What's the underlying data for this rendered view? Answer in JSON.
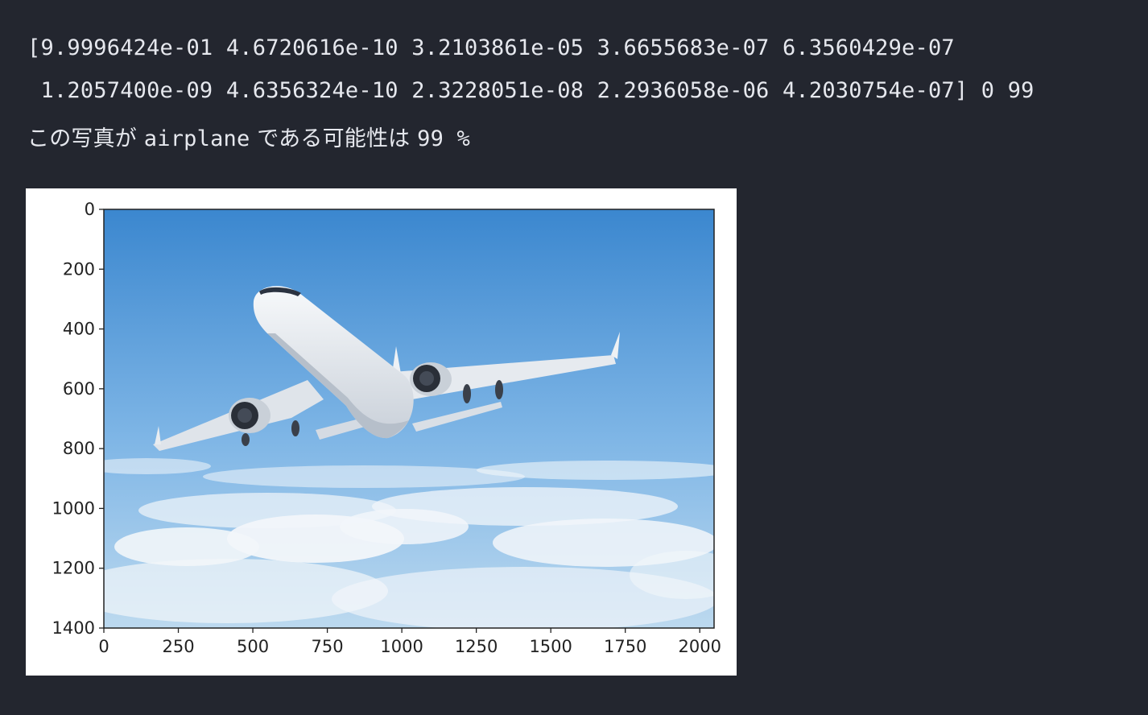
{
  "output": {
    "line1": "[9.9996424e-01 4.6720616e-10 3.2103861e-05 3.6655683e-07 6.3560429e-07",
    "line2": " 1.2057400e-09 4.6356324e-10 2.3228051e-08 2.2936058e-06 4.2030754e-07] 0 99",
    "line3": {
      "prefix": "この写真が ",
      "label": "airplane",
      "middle": " である可能性は ",
      "percent": "99",
      "suffix": " %"
    }
  },
  "figure": {
    "image_subject": "airplane flying above clouds",
    "colors": {
      "sky_top": "#3b87cf",
      "sky_mid": "#7fb6e6",
      "sky_low": "#bcd9ef",
      "cloud": "#f2f6fa",
      "plane_body": "#eef1f5",
      "engine_dark": "#2a2f38"
    }
  },
  "chart_data": {
    "type": "image",
    "xlim": [
      0,
      2048
    ],
    "ylim": [
      1400,
      0
    ],
    "x_ticks": [
      "0",
      "250",
      "500",
      "750",
      "1000",
      "1250",
      "1500",
      "1750",
      "2000"
    ],
    "x_tick_values": [
      0,
      250,
      500,
      750,
      1000,
      1250,
      1500,
      1750,
      2000
    ],
    "y_ticks": [
      "0",
      "200",
      "400",
      "600",
      "800",
      "1000",
      "1200",
      "1400"
    ],
    "y_tick_values": [
      0,
      200,
      400,
      600,
      800,
      1000,
      1200,
      1400
    ]
  }
}
